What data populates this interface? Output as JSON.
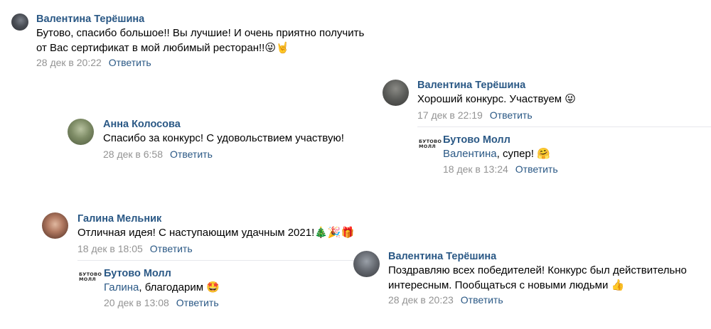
{
  "comments": [
    {
      "author": "Валентина Терёшина",
      "text_line1": "Бутово, спасибо большое!! Вы лучшие! И очень приятно получить",
      "text_line2": "от Вас сертификат в мой любимый ресторан!!",
      "emojis": "😜🤘",
      "date": "28 дек в 20:22",
      "reply": "Ответить"
    },
    {
      "author": "Валентина Терёшина",
      "text": "Хороший конкурс. Участвуем",
      "emojis": "😜",
      "date": "17 дек в 22:19",
      "reply": "Ответить",
      "answer": {
        "author": "Бутово Молл",
        "logo_line1": "БУТОВО",
        "logo_line2": "МОЛЛ",
        "mention": "Валентина",
        "text": ", супер!",
        "emojis": "🤗",
        "date": "18 дек в 13:24",
        "reply": "Ответить"
      }
    },
    {
      "author": "Анна Колосова",
      "text": "Спасибо за конкурс! С удовольствием участвую!",
      "date": "28 дек в 6:58",
      "reply": "Ответить"
    },
    {
      "author": "Галина Мельник",
      "text": "Отличная идея! С наступающим удачным 2021!",
      "emojis": "🎄🎉🎁",
      "date": "18 дек в 18:05",
      "reply": "Ответить",
      "answer": {
        "author": "Бутово Молл",
        "logo_line1": "БУТОВО",
        "logo_line2": "МОЛЛ",
        "mention": "Галина",
        "text": ", благодарим",
        "emojis": "🤩",
        "date": "20 дек в 13:08",
        "reply": "Ответить"
      }
    },
    {
      "author": "Валентина Терёшина",
      "text_line1": "Поздравляю всех победителей! Конкурс был действительно",
      "text_line2": "интересным. Пообщаться с новыми людьми",
      "emojis": "👍",
      "date": "28 дек в 20:23",
      "reply": "Ответить"
    }
  ]
}
